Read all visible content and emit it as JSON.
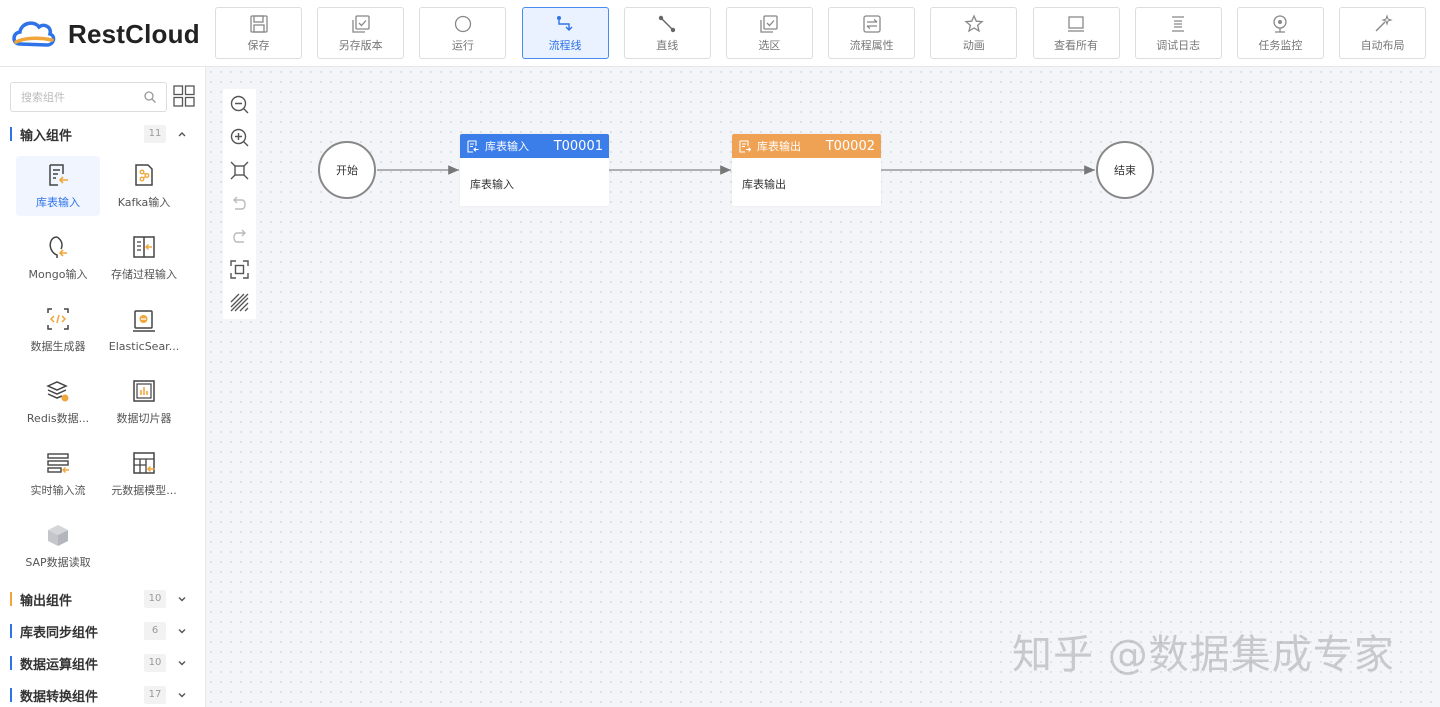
{
  "app": {
    "name": "RestCloud"
  },
  "toolbar": [
    {
      "label": "保存",
      "icon": "save-icon"
    },
    {
      "label": "另存版本",
      "icon": "save-version-icon"
    },
    {
      "label": "运行",
      "icon": "run-icon"
    },
    {
      "label": "流程线",
      "icon": "flow-line-icon",
      "active": true
    },
    {
      "label": "直线",
      "icon": "straight-line-icon"
    },
    {
      "label": "选区",
      "icon": "selection-icon"
    },
    {
      "label": "流程属性",
      "icon": "flow-properties-icon"
    },
    {
      "label": "动画",
      "icon": "star-icon"
    },
    {
      "label": "查看所有",
      "icon": "view-all-icon"
    },
    {
      "label": "调试日志",
      "icon": "debug-log-icon"
    },
    {
      "label": "任务监控",
      "icon": "monitor-icon"
    },
    {
      "label": "自动布局",
      "icon": "auto-layout-icon"
    }
  ],
  "sidebar": {
    "search_placeholder": "搜索组件",
    "categories": [
      {
        "name": "输入组件",
        "count": "11",
        "expanded": true
      },
      {
        "name": "输出组件",
        "count": "10",
        "expanded": false
      },
      {
        "name": "库表同步组件",
        "count": "6",
        "expanded": false
      },
      {
        "name": "数据运算组件",
        "count": "10",
        "expanded": false
      },
      {
        "name": "数据转换组件",
        "count": "17",
        "expanded": false
      }
    ],
    "components": [
      {
        "label": "库表输入",
        "selected": true
      },
      {
        "label": "Kafka输入"
      },
      {
        "label": "Mongo输入"
      },
      {
        "label": "存储过程输入"
      },
      {
        "label": "数据生成器"
      },
      {
        "label": "ElasticSear..."
      },
      {
        "label": "Redis数据..."
      },
      {
        "label": "数据切片器"
      },
      {
        "label": "实时输入流"
      },
      {
        "label": "元数据模型..."
      },
      {
        "label": "SAP数据读取"
      }
    ]
  },
  "canvas": {
    "start_label": "开始",
    "end_label": "结束",
    "tasks": [
      {
        "name": "库表输入",
        "id": "T00001",
        "body": "库表输入",
        "color": "#3b7de9"
      },
      {
        "name": "库表输出",
        "id": "T00002",
        "body": "库表输出",
        "color": "#f0a254"
      }
    ]
  },
  "watermark": "知乎 @数据集成专家"
}
